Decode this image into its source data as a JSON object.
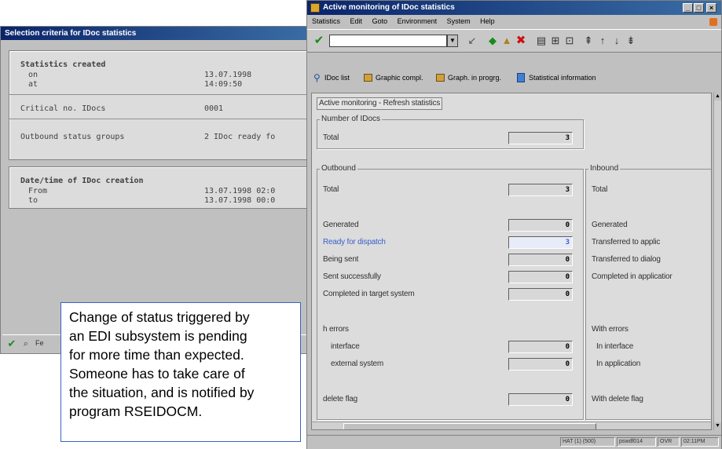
{
  "back_window": {
    "title": "Selection criteria for IDoc statistics",
    "stats": {
      "heading": "Statistics created",
      "on_label": "on",
      "on_value": "13.07.1998",
      "at_label": "at",
      "at_value": "14:09:50",
      "critical_label": "Critical no. IDocs",
      "critical_value": "0001",
      "outbound_label": "Outbound status groups",
      "outbound_value": "2  IDoc ready fo"
    },
    "datetime": {
      "heading": "Date/time of IDoc creation",
      "from_label": "From",
      "from_value": "13.07.1998  02:0",
      "to_label": "to",
      "to_value": "13.07.1998  00:0"
    },
    "bottom_label": "Fe"
  },
  "front_window": {
    "title": "Active monitoring of IDoc statistics",
    "menu": [
      "Statistics",
      "Edit",
      "Goto",
      "Environment",
      "System",
      "Help"
    ],
    "appbar": {
      "idoc_list": "IDoc list",
      "graphic_compl": "Graphic compl.",
      "graph_in_progr": "Graph. in progrg.",
      "statistical_info": "Statistical information"
    },
    "tab_label": "Active monitoring - Refresh statistics",
    "number_of_idocs": {
      "title": "Number of IDocs",
      "total_label": "Total",
      "total_value": "3"
    },
    "outbound": {
      "title": "Outbound",
      "total_label": "Total",
      "total_value": "3",
      "rows": [
        {
          "label": "Generated",
          "value": "0"
        },
        {
          "label": "Ready for dispatch",
          "value": "3"
        },
        {
          "label": "Being sent",
          "value": "0"
        },
        {
          "label": "Sent successfully",
          "value": "0"
        },
        {
          "label": "Completed in target system",
          "value": "0"
        }
      ],
      "errors_label": "h errors",
      "error_rows": [
        {
          "label": "interface",
          "value": "0"
        },
        {
          "label": "external system",
          "value": "0"
        }
      ],
      "delete_label": "delete flag",
      "delete_value": "0"
    },
    "inbound": {
      "title": "Inbound",
      "total_label": "Total",
      "rows": [
        "Generated",
        "Transferred to applic",
        "Transferred to dialog",
        "Completed in applicatior"
      ],
      "errors_label": "With errors",
      "error_rows": [
        "In interface",
        "In application"
      ],
      "delete_label": "With delete flag"
    },
    "statusbar": {
      "cell1": "HAT (1) (500)",
      "cell2": "pswdf014",
      "cell3": "OVR",
      "cell4": "02:11PM"
    }
  },
  "callout": {
    "text": "Change of status triggered by\nan EDI subsystem is pending\nfor more time than expected.\nSomeone has to take care of\nthe situation, and is notified by\nprogram RSEIDOCM."
  },
  "colors": {
    "titlebar": "#0a246a",
    "window_bg": "#c0c0c0",
    "highlight_blue": "#3a5fcd",
    "callout_border": "#3a62c0"
  }
}
